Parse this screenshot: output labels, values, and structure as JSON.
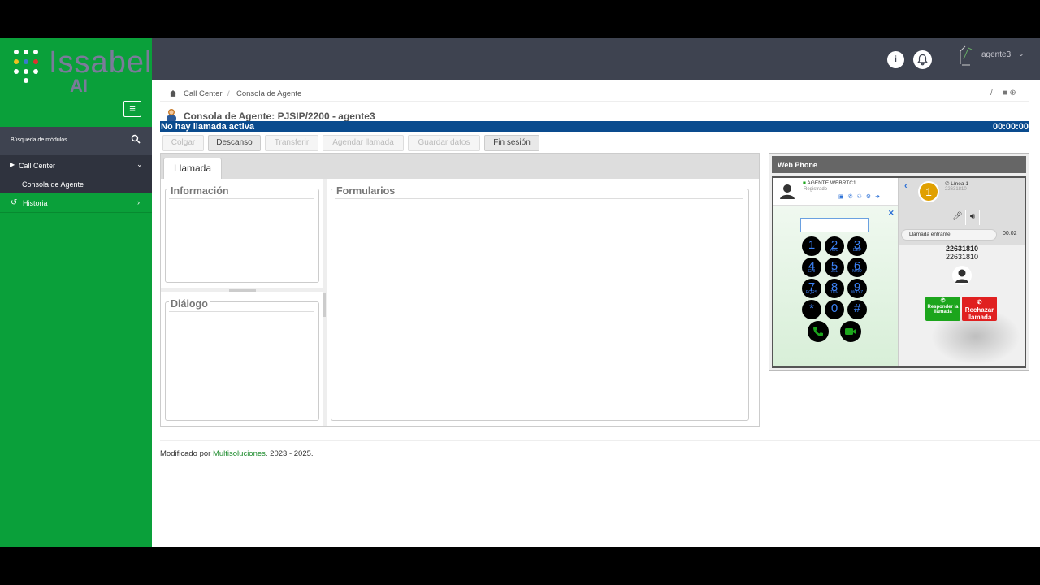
{
  "sidebar": {
    "logo_text": "Issabel",
    "logo_sub": "AI",
    "search_label": "Búsqueda de módulos",
    "items": [
      {
        "label": "Call Center"
      },
      {
        "label": "Consola de Agente"
      },
      {
        "label": "Historia"
      }
    ]
  },
  "topbar": {
    "user_name": "agente3",
    "info_icon": "info-icon",
    "bell_icon": "bell-icon"
  },
  "breadcrumb": {
    "items": [
      "Call Center",
      "Consola de Agente"
    ],
    "separator": "/",
    "right_separator": "/"
  },
  "console": {
    "title": "Consola de Agente: PJSIP/2200 - agente3",
    "status_text": "No hay llamada activa",
    "status_timer": "00:00:00",
    "status_color": "#0a4b8e"
  },
  "toolbar": {
    "buttons": [
      {
        "label": "Colgar",
        "enabled": false
      },
      {
        "label": "Descanso",
        "enabled": true
      },
      {
        "label": "Transferir",
        "enabled": false
      },
      {
        "label": "Agendar llamada",
        "enabled": false
      },
      {
        "label": "Guardar datos",
        "enabled": false
      },
      {
        "label": "Fin sesión",
        "enabled": true
      }
    ]
  },
  "main": {
    "tab": "Llamada",
    "sections": {
      "info": "Información",
      "dialog": "Diálogo",
      "forms": "Formularios"
    }
  },
  "webphone": {
    "title": "Web Phone",
    "agent_name": "AGENTE WEBRTC1",
    "agent_status": "Registrado",
    "keys": [
      {
        "digit": "1",
        "sub": ""
      },
      {
        "digit": "2",
        "sub": "ABC"
      },
      {
        "digit": "3",
        "sub": "DEF"
      },
      {
        "digit": "4",
        "sub": "GHI"
      },
      {
        "digit": "5",
        "sub": "JKL"
      },
      {
        "digit": "6",
        "sub": "MNO"
      },
      {
        "digit": "7",
        "sub": "PQRS"
      },
      {
        "digit": "8",
        "sub": "TUV"
      },
      {
        "digit": "9",
        "sub": "WXYZ"
      },
      {
        "digit": "*",
        "sub": ""
      },
      {
        "digit": "0",
        "sub": ""
      },
      {
        "digit": "#",
        "sub": ""
      }
    ],
    "line_badge": "1",
    "line_label": "Línea 1",
    "line_number": "22631810",
    "incoming_label": "Llamada entrante",
    "call_timer": "00:02",
    "caller_number": "22631810",
    "caller_number_2": "22631810",
    "answer_label": "Responder la llamada",
    "reject_label": "Rechazar llamada",
    "colors": {
      "answer": "#1ca51c",
      "reject": "#e02020",
      "badge": "#e0a000",
      "keys": "#3b82f6"
    }
  },
  "footer": {
    "prefix": "Modificado por ",
    "link_text": "Multisoluciones",
    "suffix": ". 2023 - 2025."
  }
}
